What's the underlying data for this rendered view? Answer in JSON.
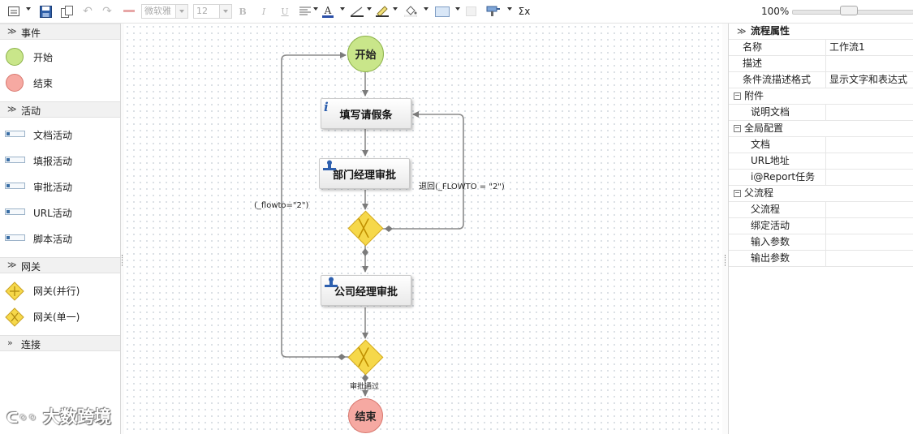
{
  "toolbar": {
    "font_name": "微软雅",
    "font_size": "12",
    "bold": "B",
    "italic": "I",
    "underline": "U",
    "font_color_glyph": "A",
    "formula_glyph": "Σx",
    "zoom": "100%"
  },
  "palette": {
    "sections": {
      "events": "事件",
      "activities": "活动",
      "gateways": "网关",
      "connections": "连接"
    },
    "events": [
      {
        "label": "开始",
        "icon": "start-event-icon"
      },
      {
        "label": "结束",
        "icon": "end-event-icon"
      }
    ],
    "activities": [
      {
        "label": "文档活动",
        "icon": "document-activity-icon"
      },
      {
        "label": "填报活动",
        "icon": "fill-activity-icon"
      },
      {
        "label": "审批活动",
        "icon": "approval-activity-icon"
      },
      {
        "label": "URL活动",
        "icon": "url-activity-icon"
      },
      {
        "label": "脚本活动",
        "icon": "script-activity-icon"
      }
    ],
    "gateways": [
      {
        "label": "网关(并行)",
        "icon": "parallel-gateway-icon"
      },
      {
        "label": "网关(单一)",
        "icon": "exclusive-gateway-icon"
      }
    ]
  },
  "canvas": {
    "start": "开始",
    "end": "结束",
    "task_fill": "填写请假条",
    "task_dept": "部门经理审批",
    "task_company": "公司经理审批",
    "edge_return": "退回(_FLOWTO = \"2\")",
    "edge_loop": "(_flowto=\"2\")",
    "edge_pass": "审批通过"
  },
  "properties": {
    "header": "流程属性",
    "rows": {
      "name_key": "名称",
      "name_value": "工作流1",
      "desc_key": "描述",
      "desc_value": "",
      "cond_key": "条件流描述格式",
      "cond_value": "显示文字和表达式"
    },
    "cat_attach": "附件",
    "attach_doc": "说明文档",
    "cat_global": "全局配置",
    "global_doc": "文档",
    "global_url": "URL地址",
    "global_report": "i@Report任务",
    "cat_parent": "父流程",
    "parent_flow": "父流程",
    "parent_bind": "绑定活动",
    "parent_input": "输入参数",
    "parent_output": "输出参数"
  },
  "watermark": "大数跨境",
  "colors": {
    "start_fill": "#c9e68a",
    "end_fill": "#f6a9a2",
    "gateway_fill": "#f6d84a",
    "edge": "#7b7b7b"
  }
}
